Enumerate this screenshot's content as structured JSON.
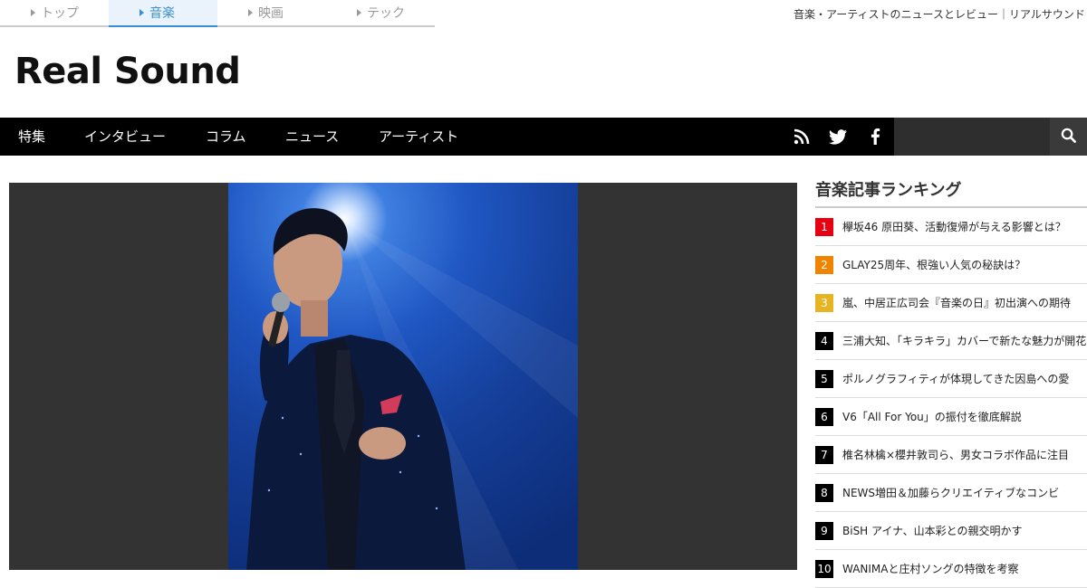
{
  "section_tabs": [
    {
      "label": "トップ",
      "active": false
    },
    {
      "label": "音楽",
      "active": true
    },
    {
      "label": "映画",
      "active": false
    },
    {
      "label": "テック",
      "active": false
    }
  ],
  "tagline": "音楽・アーティストのニュースとレビュー｜リアルサウンド",
  "logo_text": "Real Sound",
  "main_nav": [
    "特集",
    "インタビュー",
    "コラム",
    "ニュース",
    "アーティスト"
  ],
  "social_icons": [
    "rss-icon",
    "twitter-icon",
    "facebook-icon"
  ],
  "search": {
    "placeholder": ""
  },
  "sidebar": {
    "title": "音楽記事ランキング",
    "ranking": [
      {
        "rank": "1",
        "title": "欅坂46 原田葵、活動復帰が与える影響とは？",
        "color": "#e60012"
      },
      {
        "rank": "2",
        "title": "GLAY25周年、根強い人気の秘訣は？",
        "color": "#f08300"
      },
      {
        "rank": "3",
        "title": "嵐、中居正広司会『音楽の日』初出演への期待",
        "color": "#e6b422"
      },
      {
        "rank": "4",
        "title": "三浦大知、「キラキラ」カバーで新たな魅力が開花",
        "color": "#000000"
      },
      {
        "rank": "5",
        "title": "ポルノグラフィティが体現してきた因島への愛",
        "color": "#000000"
      },
      {
        "rank": "6",
        "title": "V6「All For You」の振付を徹底解説",
        "color": "#000000"
      },
      {
        "rank": "7",
        "title": "椎名林檎×櫻井敦司ら、男女コラボ作品に注目",
        "color": "#000000"
      },
      {
        "rank": "8",
        "title": "NEWS増田＆加藤らクリエイティブなコンビ",
        "color": "#000000"
      },
      {
        "rank": "9",
        "title": "BiSH アイナ、山本彩との親交明かす",
        "color": "#000000"
      },
      {
        "rank": "10",
        "title": "WANIMAと庄村ソングの特徴を考察",
        "color": "#000000"
      }
    ]
  },
  "colors": {
    "accent": "#3a8fd6",
    "nav_bg": "#000000",
    "hero_bg": "#333333"
  }
}
